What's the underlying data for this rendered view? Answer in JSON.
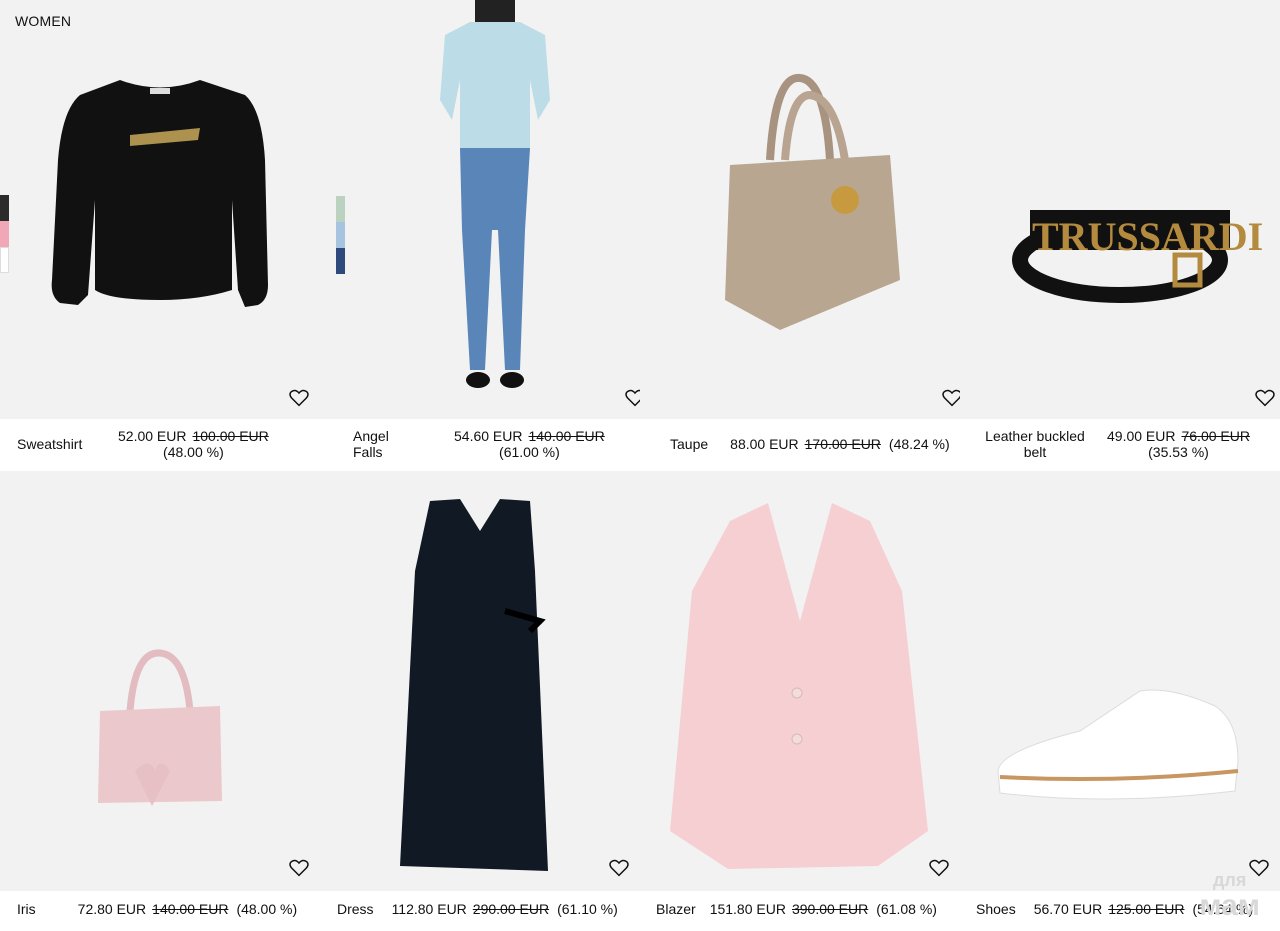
{
  "section": {
    "title": "WOMEN"
  },
  "colors": {
    "tile_bg": "#f2f2f2",
    "text": "#111111"
  },
  "products": [
    {
      "name": "Sweatshirt",
      "price": "52.00 EUR",
      "old_price": "100.00 EUR",
      "discount": "(48.00 %)",
      "icon": "heart-icon"
    },
    {
      "name": "Angel Falls",
      "price": "54.60 EUR",
      "old_price": "140.00 EUR",
      "discount": "(61.00 %)",
      "icon": "heart-icon"
    },
    {
      "name": "Taupe",
      "price": "88.00 EUR",
      "old_price": "170.00 EUR",
      "discount": "(48.24 %)",
      "icon": "heart-icon"
    },
    {
      "name": "Leather buckled belt",
      "price": "49.00 EUR",
      "old_price": "76.00 EUR",
      "discount": "(35.53 %)",
      "icon": "heart-icon"
    },
    {
      "name": "Iris",
      "price": "72.80 EUR",
      "old_price": "140.00 EUR",
      "discount": "(48.00 %)",
      "icon": "heart-icon"
    },
    {
      "name": "Dress",
      "price": "112.80 EUR",
      "old_price": "290.00 EUR",
      "discount": "(61.10 %)",
      "icon": "heart-icon"
    },
    {
      "name": "Blazer",
      "price": "151.80 EUR",
      "old_price": "390.00 EUR",
      "discount": "(61.08 %)",
      "icon": "heart-icon"
    },
    {
      "name": "Shoes",
      "price": "56.70 EUR",
      "old_price": "125.00 EUR",
      "discount": "(54.64 %)",
      "icon": "heart-icon"
    }
  ],
  "swatches": {
    "sweatshirt": [
      "#2b2b2b",
      "#f2a7b8",
      "#ffffff"
    ],
    "angel_falls": [
      "#bcd2c0",
      "#a6c4df",
      "#2e4a7d"
    ]
  },
  "watermark": {
    "line1": "для",
    "line2": "мам"
  }
}
